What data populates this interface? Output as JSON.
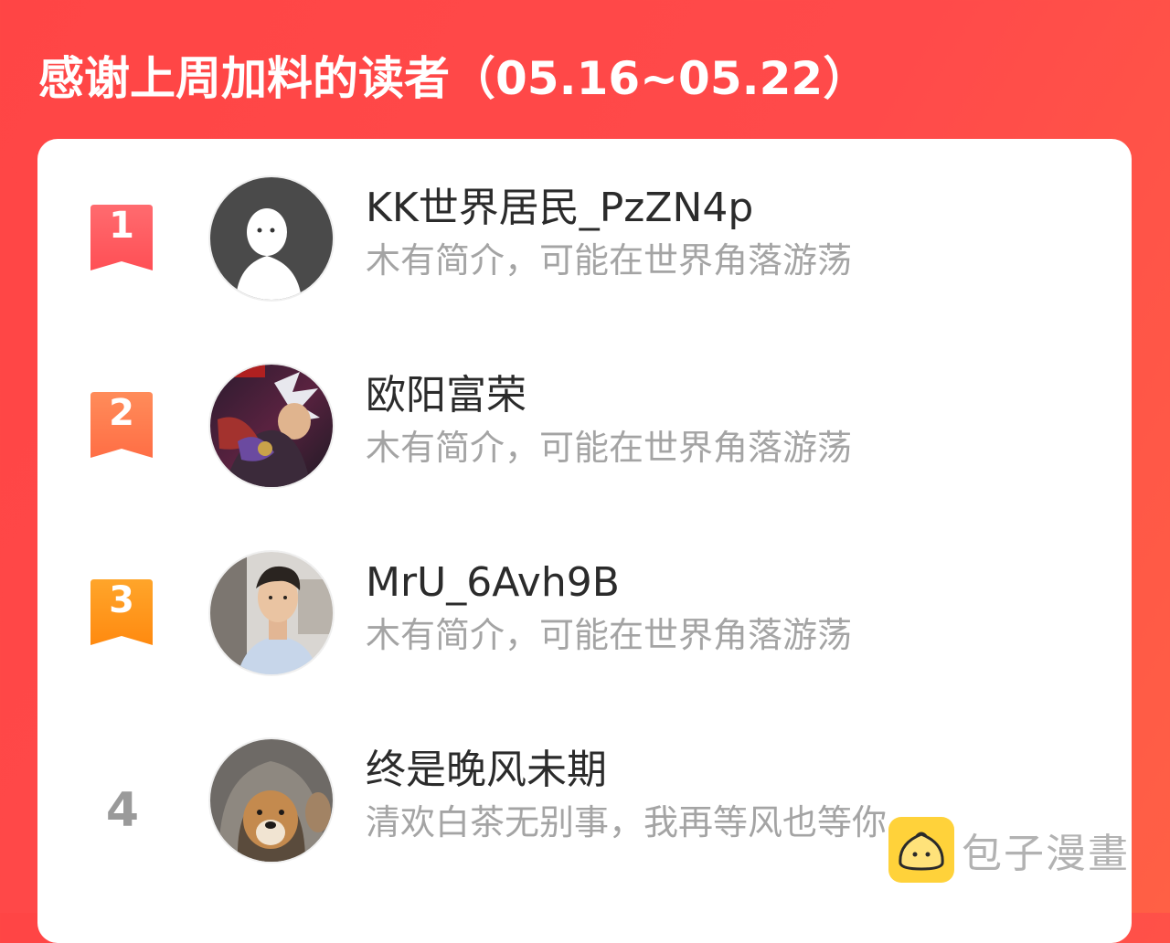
{
  "header": {
    "title": "感谢上周加料的读者（05.16~05.22）"
  },
  "readers": [
    {
      "rank": "1",
      "name": "KK世界居民_PzZN4p",
      "bio": "木有简介，可能在世界角落游荡",
      "avatar": "default-silhouette-avatar",
      "badge_color": "#ff5a5f"
    },
    {
      "rank": "2",
      "name": "欧阳富荣",
      "bio": "木有简介，可能在世界角落游荡",
      "avatar": "anime-character-avatar",
      "badge_color": "#ff7a4a"
    },
    {
      "rank": "3",
      "name": "MrU_6Avh9B",
      "bio": "木有简介，可能在世界角落游荡",
      "avatar": "man-photo-avatar",
      "badge_color": "#ff9a1a"
    },
    {
      "rank": "4",
      "name": "终是晚风未期",
      "bio": "清欢白茶无别事，我再等风也等你",
      "avatar": "dog-in-hoodie-avatar"
    }
  ],
  "watermark": {
    "text": "包子漫畫",
    "icon": "baozi-bun-icon"
  },
  "colors": {
    "background": "#ff4a4a",
    "card": "#ffffff",
    "name": "#2b2b2b",
    "bio": "#a4a4a4"
  }
}
